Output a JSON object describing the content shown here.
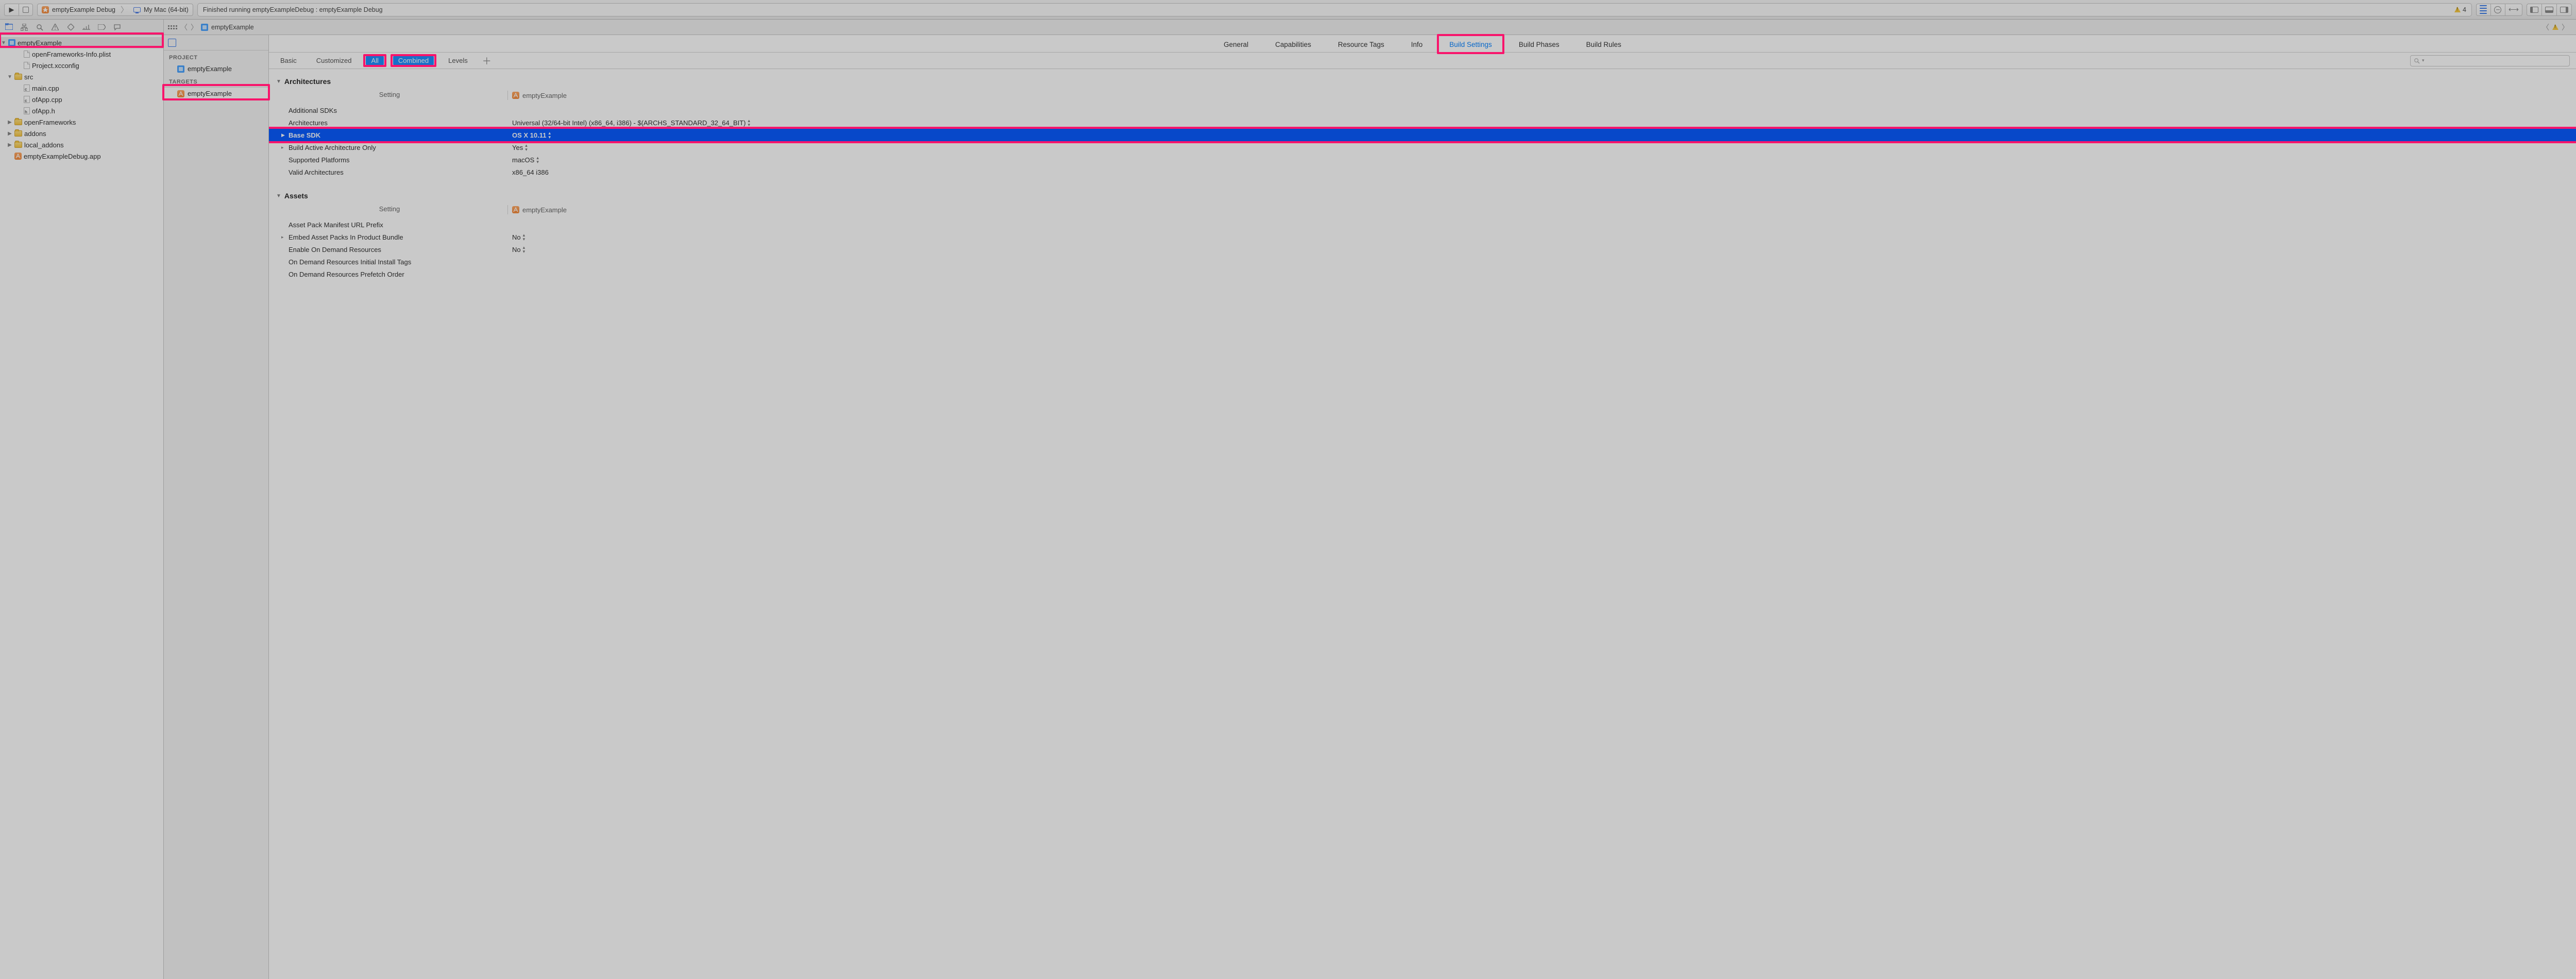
{
  "toolbar": {
    "scheme_target": "emptyExample Debug",
    "scheme_device": "My Mac (64-bit)",
    "status_text": "Finished running emptyExampleDebug : emptyExample Debug",
    "warn_count": "4"
  },
  "breadcrumb": {
    "file": "emptyExample"
  },
  "filetree": {
    "root": "emptyExample",
    "items": [
      {
        "name": "openFrameworks-Info.plist",
        "kind": "plist",
        "indent": 1
      },
      {
        "name": "Project.xcconfig",
        "kind": "file",
        "indent": 1
      },
      {
        "name": "src",
        "kind": "folder",
        "indent": 0,
        "open": true
      },
      {
        "name": "main.cpp",
        "kind": "cpp",
        "indent": 1
      },
      {
        "name": "ofApp.cpp",
        "kind": "cpp",
        "indent": 1
      },
      {
        "name": "ofApp.h",
        "kind": "h",
        "indent": 1
      },
      {
        "name": "openFrameworks",
        "kind": "folder",
        "indent": 0,
        "open": false
      },
      {
        "name": "addons",
        "kind": "folder",
        "indent": 0,
        "open": false
      },
      {
        "name": "local_addons",
        "kind": "folder",
        "indent": 0,
        "open": false
      },
      {
        "name": "emptyExampleDebug.app",
        "kind": "app",
        "indent": 0
      }
    ]
  },
  "targets": {
    "project_header": "PROJECT",
    "project_name": "emptyExample",
    "targets_header": "TARGETS",
    "target_name": "emptyExample"
  },
  "tabs": {
    "general": "General",
    "capabilities": "Capabilities",
    "resource_tags": "Resource Tags",
    "info": "Info",
    "build_settings": "Build Settings",
    "build_phases": "Build Phases",
    "build_rules": "Build Rules"
  },
  "scope": {
    "basic": "Basic",
    "customized": "Customized",
    "all": "All",
    "combined": "Combined",
    "levels": "Levels"
  },
  "search": {
    "placeholder": ""
  },
  "columns": {
    "setting": "Setting",
    "target": "emptyExample"
  },
  "sections": {
    "arch": {
      "title": "Architectures",
      "rows": {
        "additional_sdks": {
          "label": "Additional SDKs",
          "value": ""
        },
        "architectures": {
          "label": "Architectures",
          "value": "Universal (32/64-bit Intel) (x86_64, i386)  -  $(ARCHS_STANDARD_32_64_BIT)"
        },
        "base_sdk": {
          "label": "Base SDK",
          "value": "OS X 10.11"
        },
        "build_active_only": {
          "label": "Build Active Architecture Only",
          "value": "Yes"
        },
        "supported_plat": {
          "label": "Supported Platforms",
          "value": "macOS"
        },
        "valid_arch": {
          "label": "Valid Architectures",
          "value": "x86_64 i386"
        }
      }
    },
    "assets": {
      "title": "Assets",
      "rows": {
        "manifest_prefix": {
          "label": "Asset Pack Manifest URL Prefix",
          "value": ""
        },
        "embed_packs": {
          "label": "Embed Asset Packs In Product Bundle",
          "value": "No"
        },
        "enable_odr": {
          "label": "Enable On Demand Resources",
          "value": "No"
        },
        "odr_initial": {
          "label": "On Demand Resources Initial Install Tags",
          "value": ""
        },
        "odr_prefetch": {
          "label": "On Demand Resources Prefetch Order",
          "value": ""
        }
      }
    }
  }
}
